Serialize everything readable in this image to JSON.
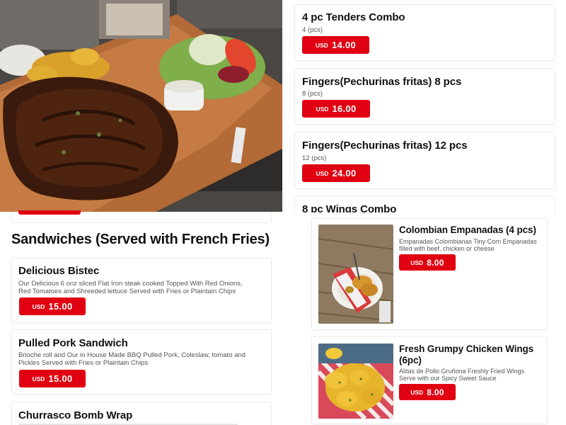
{
  "top_right_items": [
    {
      "title": "4 pc Tenders Combo",
      "subtitle": "4 (pcs)",
      "currency": "USD",
      "price": "14.00"
    },
    {
      "title": "Fingers(Pechurinas fritas) 8 pcs",
      "subtitle": "8 (pcs)",
      "currency": "USD",
      "price": "16.00"
    },
    {
      "title": "Fingers(Pechurinas fritas) 12 pcs",
      "subtitle": "12 (pcs)",
      "currency": "USD",
      "price": "24.00"
    },
    {
      "title": "8 pc Wings Combo"
    }
  ],
  "section": {
    "title": "Sandwiches (Served with French Fries)"
  },
  "sandwiches": [
    {
      "title": "Delicious Bistec",
      "description_line1": "Our Delicious 6 onz sliced Flat Iron steak cooked Topped With Red Onions,",
      "description_line2": "Red Tomatoes and Shreeded lettuce Served with Fries or Plaintain Chips",
      "currency": "USD",
      "price": "15.00"
    },
    {
      "title": "Pulled Pork Sandwich",
      "description_line1": "Brioche roll and Our in House Made BBQ Pulled Pork, Coleslaw, tomato and",
      "description_line2": "Pickles Served with Fries or Plaintain Chips",
      "currency": "USD",
      "price": "15.00"
    },
    {
      "title": "Churrasco Bomb Wrap"
    }
  ],
  "right_items": [
    {
      "title": "Colombian Empanadas (4 pcs)",
      "description_line1": "Empanadas Colombianas Tiny Corn Empanadas",
      "description_line2": "filled with beef, chicken or cheese",
      "currency": "USD",
      "price": "8.00",
      "image_icon": "empanadas-photo"
    },
    {
      "title_line1": "Fresh Grumpy Chicken Wings",
      "title_line2": "(6pc)",
      "description_line1": "Alitas de Pollo Gruñona Freshly Fried Wings",
      "description_line2": "Serve with our Spicy Sweet Sauce",
      "currency": "USD",
      "price": "8.00",
      "image_icon": "chicken-wings-photo"
    }
  ],
  "colors": {
    "accent": "#e00012",
    "border": "#ececec"
  }
}
